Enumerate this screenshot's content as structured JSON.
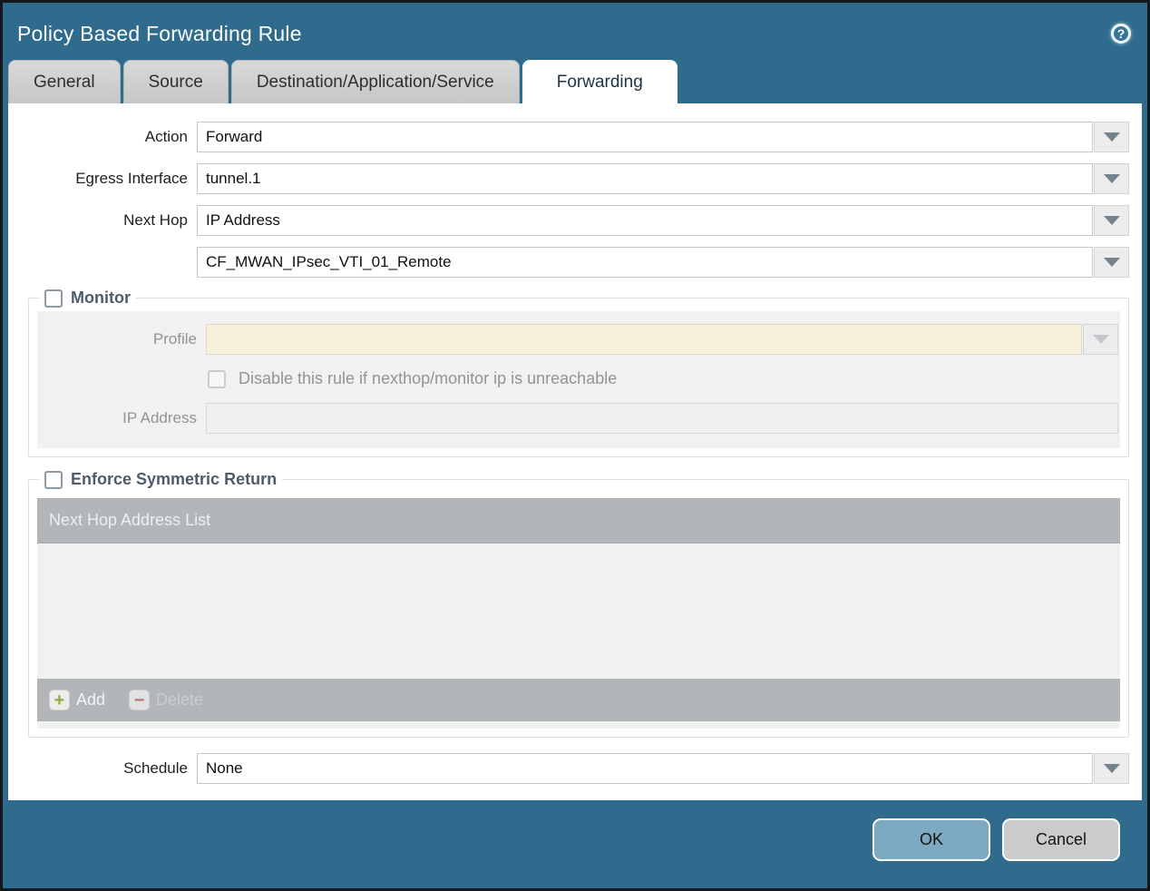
{
  "window": {
    "title": "Policy Based Forwarding Rule"
  },
  "tabs": [
    {
      "label": "General",
      "active": false
    },
    {
      "label": "Source",
      "active": false
    },
    {
      "label": "Destination/Application/Service",
      "active": false
    },
    {
      "label": "Forwarding",
      "active": true
    }
  ],
  "form": {
    "action": {
      "label": "Action",
      "value": "Forward"
    },
    "egress_interface": {
      "label": "Egress Interface",
      "value": "tunnel.1"
    },
    "next_hop": {
      "label": "Next Hop",
      "value": "IP Address"
    },
    "next_hop_address": {
      "value": "CF_MWAN_IPsec_VTI_01_Remote"
    },
    "schedule": {
      "label": "Schedule",
      "value": "None"
    }
  },
  "monitor": {
    "legend": "Monitor",
    "checked": false,
    "profile": {
      "label": "Profile",
      "value": ""
    },
    "disable_rule": {
      "label": "Disable this rule if nexthop/monitor ip is unreachable",
      "checked": false
    },
    "ip_address": {
      "label": "IP Address",
      "value": ""
    }
  },
  "symmetric_return": {
    "legend": "Enforce Symmetric Return",
    "checked": false,
    "table": {
      "header": "Next Hop Address List",
      "rows": [],
      "add_label": "Add",
      "delete_label": "Delete"
    }
  },
  "footer": {
    "ok_label": "OK",
    "cancel_label": "Cancel"
  },
  "icons": {
    "help": "help-icon",
    "dropdown": "chevron-down-icon",
    "add": "plus-icon",
    "delete": "minus-icon"
  },
  "colors": {
    "chrome_teal": "#2e6b8d",
    "active_tab_text": "#1d3345",
    "inactive_tab_bg": "#cccccc",
    "section_legend_text": "#4d5c6b",
    "table_chrome_gray": "#b2b6b9",
    "profile_field_beige": "#f7f0da",
    "add_icon_green": "#8fa944",
    "delete_icon_red": "#b3766c",
    "ok_button_bg": "#7da9c1",
    "cancel_button_bg": "#c9cbcd"
  }
}
